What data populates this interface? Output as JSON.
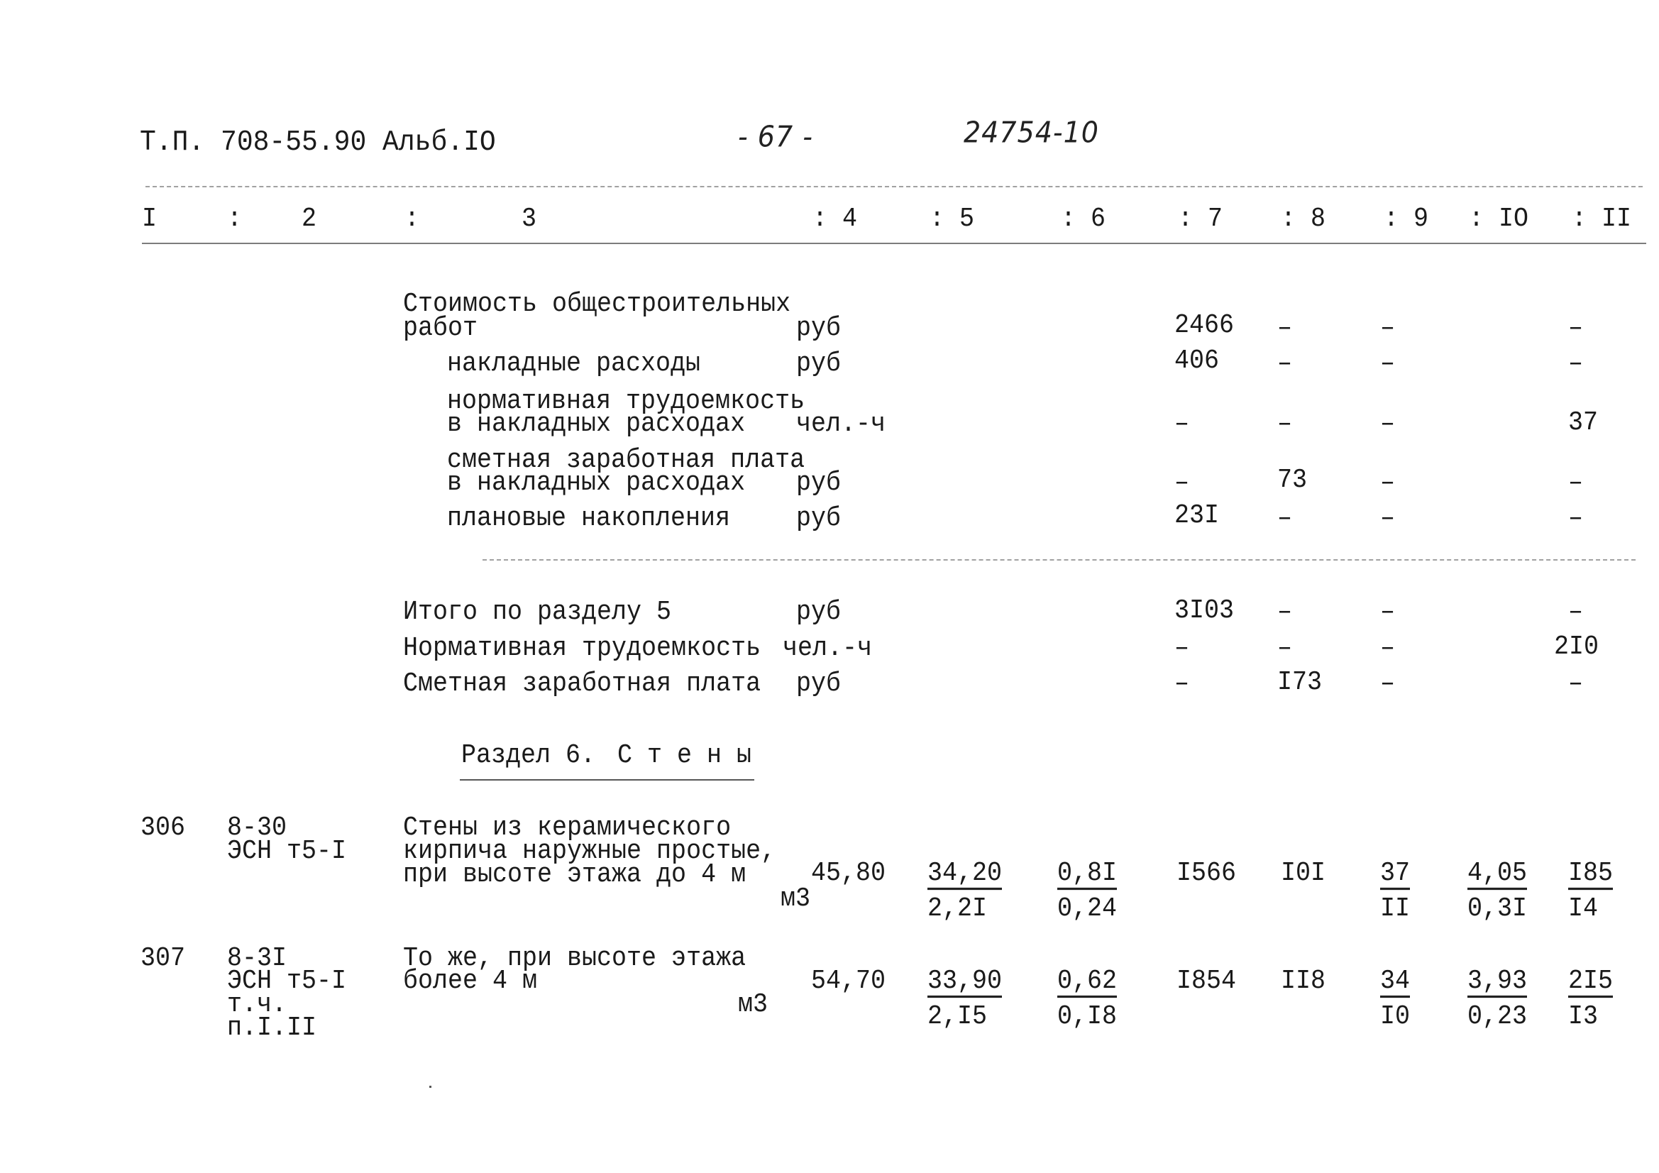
{
  "header": {
    "doc_ref": "Т.П. 708-55.90 Альб.IO",
    "page_number": "- 67 -",
    "inventory_number": "24754-10"
  },
  "column_headers": [
    "I",
    ":",
    "2",
    ":",
    "3",
    ": 4",
    ": 5",
    ": 6",
    ": 7",
    ": 8",
    ": 9",
    ": IO",
    ": II"
  ],
  "section5_summary": {
    "rows": [
      {
        "label_lines": [
          "Стоимость общестроительных",
          "работ"
        ],
        "unit": "руб",
        "c7": "2466",
        "c8": "–",
        "c9": "–",
        "c11": "–"
      },
      {
        "label_lines": [
          "накладные расходы"
        ],
        "unit": "руб",
        "c7": "406",
        "c8": "–",
        "c9": "–",
        "c11": "–"
      },
      {
        "label_lines": [
          "нормативная трудоемкость",
          "в накладных расходах"
        ],
        "unit": "чел.-ч",
        "c7": "–",
        "c8": "–",
        "c9": "–",
        "c11": "37"
      },
      {
        "label_lines": [
          "сметная заработная плата",
          "в накладных расходах"
        ],
        "unit": "руб",
        "c7": "–",
        "c8": "73",
        "c9": "–",
        "c11": "–"
      },
      {
        "label_lines": [
          "плановые накопления"
        ],
        "unit": "руб",
        "c7": "23I",
        "c8": "–",
        "c9": "–",
        "c11": "–"
      }
    ]
  },
  "section5_totals": {
    "rows": [
      {
        "label": "Итого по разделу 5",
        "unit": "руб",
        "c7": "3I03",
        "c8": "–",
        "c9": "–",
        "c11": "–"
      },
      {
        "label": "Нормативная трудоемкость",
        "unit": "чел.-ч",
        "c7": "–",
        "c8": "–",
        "c9": "–",
        "c11": "2I0"
      },
      {
        "label": "Сметная заработная плата",
        "unit": "руб",
        "c7": "–",
        "c8": "I73",
        "c9": "–",
        "c11": "–"
      }
    ]
  },
  "section6": {
    "title_prefix": "Раздел 6.",
    "title_name": "С т е н ы"
  },
  "items": [
    {
      "num": "306",
      "code_lines": [
        "8-30",
        "ЭСН т5-I"
      ],
      "desc_lines": [
        "Стены из керамического",
        "кирпича наружные простые,",
        "при высоте этажа до 4 м"
      ],
      "unit": "м3",
      "qty": "45,80",
      "c5_top": "34,20",
      "c5_bottom": "2,2I",
      "c6_top": "0,8I",
      "c6_bottom": "0,24",
      "c7": "I566",
      "c8": "I0I",
      "c9_top": "37",
      "c9_bottom": "II",
      "c10_top": "4,05",
      "c10_bottom": "0,3I",
      "c11_top": "I85",
      "c11_bottom": "I4"
    },
    {
      "num": "307",
      "code_lines": [
        "8-3I",
        "ЭСН т5-I",
        "т.ч.",
        "п.I.II"
      ],
      "desc_lines": [
        "То же, при высоте этажа",
        "более 4 м"
      ],
      "unit": "м3",
      "qty": "54,70",
      "c5_top": "33,90",
      "c5_bottom": "2,I5",
      "c6_top": "0,62",
      "c6_bottom": "0,I8",
      "c7": "I854",
      "c8": "II8",
      "c9_top": "34",
      "c9_bottom": "I0",
      "c10_top": "3,93",
      "c10_bottom": "0,23",
      "c11_top": "2I5",
      "c11_bottom": "I3"
    }
  ]
}
